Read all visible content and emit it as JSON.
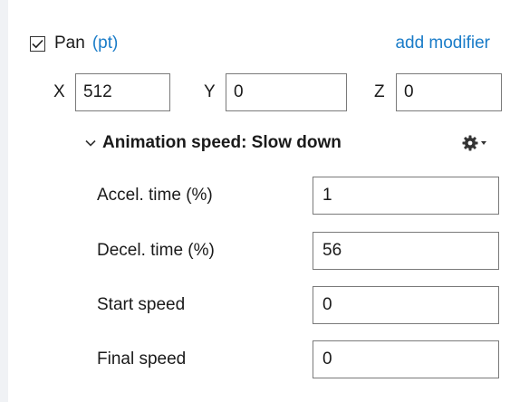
{
  "pan": {
    "checked": true,
    "label": "Pan",
    "unit": "(pt)",
    "add_modifier": "add modifier"
  },
  "coords": {
    "x_label": "X",
    "x_value": "512",
    "y_label": "Y",
    "y_value": "0",
    "z_label": "Z",
    "z_value": "0"
  },
  "animation": {
    "title": "Animation speed: Slow down",
    "fields": [
      {
        "label": "Accel. time (%)",
        "value": "1"
      },
      {
        "label": "Decel. time (%)",
        "value": "56"
      },
      {
        "label": "Start speed",
        "value": "0"
      },
      {
        "label": "Final speed",
        "value": "0"
      }
    ]
  },
  "icons": {
    "checkbox": "checkmark-icon",
    "chevron": "chevron-down-icon",
    "settings": "gear-icon",
    "dropdown": "dropdown-arrow-icon"
  },
  "colors": {
    "link": "#1a7cc8",
    "text": "#1a1a1a",
    "border": "#7a7a7a",
    "left_strip": "#f0f2f5"
  }
}
